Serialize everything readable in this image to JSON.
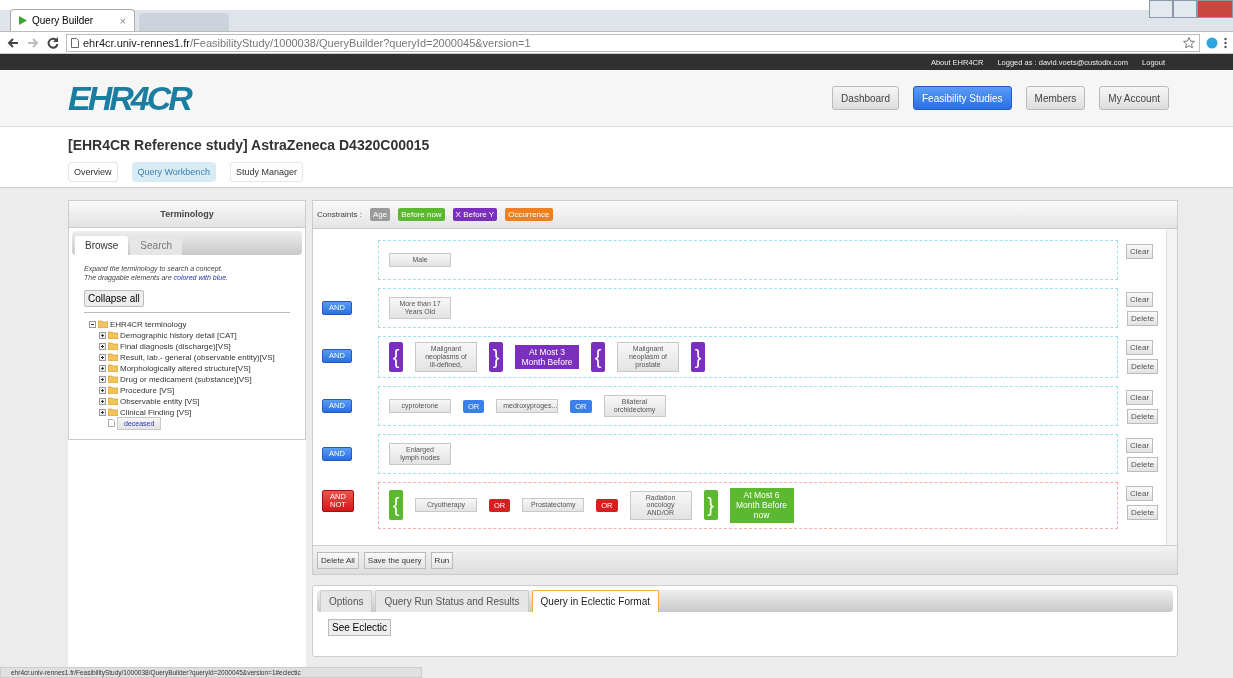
{
  "browser": {
    "tab_title": "Query Builder",
    "tab_close": "×",
    "url_host": "ehr4cr.univ-rennes1.fr",
    "url_path": "/FeasibilityStudy/1000038/QueryBuilder?queryId=2000045&version=1"
  },
  "top_bar": {
    "links": [
      "About EHR4CR",
      "Logged as : david.voets@custodix.com",
      "Logout"
    ]
  },
  "header": {
    "logo": "EHR4CR",
    "nav": [
      {
        "label": "Dashboard",
        "selected": false
      },
      {
        "label": "Feasibility Studies",
        "selected": true
      },
      {
        "label": "Members",
        "selected": false
      },
      {
        "label": "My Account",
        "selected": false
      }
    ]
  },
  "study": {
    "title": "[EHR4CR Reference study] AstraZeneca D4320C00015",
    "tabs": [
      {
        "label": "Overview",
        "selected": false
      },
      {
        "label": "Query Workbench",
        "selected": true
      },
      {
        "label": "Study Manager",
        "selected": false
      }
    ]
  },
  "terminology": {
    "title": "Terminology",
    "tabs": [
      {
        "label": "Browse",
        "selected": true
      },
      {
        "label": "Search",
        "selected": false
      }
    ],
    "hint_1": "Expand the terminology to search a concept.",
    "hint_2": "The draggable elements are",
    "hint_link": "colored with blue",
    "hint_end": ".",
    "collapse_button": "Collapse all",
    "tree": {
      "label": "EHR4CR terminology",
      "kind": "folder",
      "expanded": true,
      "children": [
        {
          "label": "Demographic history detail [CAT]",
          "kind": "folder",
          "expanded": false
        },
        {
          "label": "Final diagnosis (discharge)[VS]",
          "kind": "folder",
          "expanded": false
        },
        {
          "label": "Result, lab.- general (observable entity)[VS]",
          "kind": "folder",
          "expanded": false
        },
        {
          "label": "Morphologically altered structure[VS]",
          "kind": "folder",
          "expanded": false
        },
        {
          "label": "Drug or medicament (substance)[VS]",
          "kind": "folder",
          "expanded": false
        },
        {
          "label": "Procedure [VS]",
          "kind": "folder",
          "expanded": false
        },
        {
          "label": "Observable entity [VS]",
          "kind": "folder",
          "expanded": false
        },
        {
          "label": "Clinical Finding [VS]",
          "kind": "folder",
          "expanded": false
        },
        {
          "label": "deceased",
          "kind": "concept"
        }
      ]
    }
  },
  "query": {
    "constraints_label": "Constraints :",
    "constraints": [
      {
        "label": "Age",
        "color": "#9a9a9a"
      },
      {
        "label": "Before now",
        "color": "#5cb82e"
      },
      {
        "label": "X Before Y",
        "color": "#7b2fbf"
      },
      {
        "label": "Occurrence",
        "color": "#f07f1e"
      }
    ],
    "groups": [
      {
        "negated": false,
        "buttons": [
          "Clear"
        ],
        "items": [
          {
            "kind": "concept",
            "label": "Male"
          }
        ]
      },
      {
        "operator": "AND",
        "negated": false,
        "buttons": [
          "Clear",
          "Delete"
        ],
        "items": [
          {
            "kind": "concept",
            "label": "More than 17 Years Old"
          }
        ]
      },
      {
        "operator": "AND",
        "negated": false,
        "buttons": [
          "Clear",
          "Delete"
        ],
        "items": [
          {
            "kind": "open",
            "label": "{",
            "color": "#7b2fbf"
          },
          {
            "kind": "concept",
            "label": "Malignant neoplasms of ill-defined,"
          },
          {
            "kind": "close",
            "label": "}",
            "color": "#7b2fbf"
          },
          {
            "kind": "constraint",
            "label": "At Most 3 Month Before",
            "color": "#7b2fbf"
          },
          {
            "kind": "open",
            "label": "{",
            "color": "#7b2fbf"
          },
          {
            "kind": "concept",
            "label": "Malignant neoplasm of prostate"
          },
          {
            "kind": "close",
            "label": "}",
            "color": "#7b2fbf"
          }
        ]
      },
      {
        "operator": "AND",
        "negated": false,
        "buttons": [
          "Clear",
          "Delete"
        ],
        "items": [
          {
            "kind": "concept",
            "label": "cyproterone"
          },
          {
            "kind": "or",
            "label": "OR"
          },
          {
            "kind": "concept",
            "label": "medroxyproges..."
          },
          {
            "kind": "or",
            "label": "OR"
          },
          {
            "kind": "concept",
            "label": "Bilateral orchidectomy"
          }
        ]
      },
      {
        "operator": "AND",
        "negated": false,
        "buttons": [
          "Clear",
          "Delete"
        ],
        "items": [
          {
            "kind": "concept",
            "label": "Enlarged lymph nodes"
          }
        ]
      },
      {
        "operator": "AND NOT",
        "negated": true,
        "buttons": [
          "Clear",
          "Delete"
        ],
        "items": [
          {
            "kind": "open",
            "label": "{",
            "color": "#5cb82e"
          },
          {
            "kind": "concept",
            "label": "Cryotherapy"
          },
          {
            "kind": "or",
            "label": "OR"
          },
          {
            "kind": "concept",
            "label": "Prostatectomy"
          },
          {
            "kind": "or",
            "label": "OR"
          },
          {
            "kind": "concept",
            "label": "Radiation oncology AND/OR"
          },
          {
            "kind": "close",
            "label": "}",
            "color": "#5cb82e"
          },
          {
            "kind": "constraint",
            "label": "At Most 6 Month Before now",
            "color": "#5cb82e"
          }
        ]
      }
    ],
    "footer_buttons": [
      "Delete All",
      "Save the query",
      "Run"
    ]
  },
  "results": {
    "tabs": [
      {
        "label": "Options",
        "selected": false
      },
      {
        "label": "Query Run Status and Results",
        "selected": false
      },
      {
        "label": "Query in Eclectic Format",
        "selected": true
      }
    ],
    "button": "See Eclectic"
  },
  "status_bar": "ehr4cr.univ-rennes1.fr/FeasibilityStudy/1000038/QueryBuilder?queryId=2000045&version=1#eclectic"
}
